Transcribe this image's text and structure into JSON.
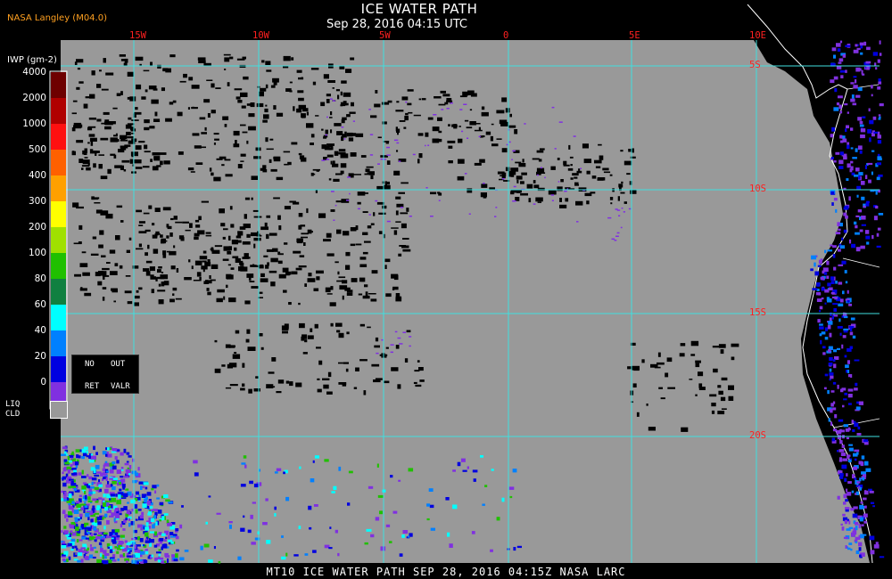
{
  "header": {
    "title": "ICE WATER PATH",
    "subtitle": "Sep 28, 2016 04:15 UTC",
    "producer": "NASA Langley (M04.0)"
  },
  "colorbar": {
    "title": "IWP (gm-2)",
    "labels": [
      "4000",
      "2000",
      "1000",
      "500",
      "400",
      "300",
      "200",
      "100",
      "80",
      "60",
      "40",
      "20",
      "0"
    ],
    "colors": [
      "#6e0000",
      "#b00000",
      "#ff1010",
      "#ff6000",
      "#ffa000",
      "#ffff00",
      "#a0e000",
      "#20c000",
      "#108040",
      "#00ffff",
      "#0080ff",
      "#0000e0",
      "#8030e0"
    ]
  },
  "legend": {
    "no_ret": [
      "NO",
      "RET"
    ],
    "out_valr": [
      "OUT",
      "VALR"
    ],
    "liq_cld": [
      "LIQ",
      "CLD"
    ]
  },
  "map": {
    "lon_labels": [
      "15W",
      "10W",
      "5W",
      "0",
      "5E",
      "10E"
    ],
    "lat_labels": [
      "5S",
      "10S",
      "15S",
      "20S"
    ],
    "grid_color": "#40e0e0",
    "ocean_color": "#999999",
    "clear_color": "#000000",
    "label_color": "#ff2020"
  },
  "footer": {
    "text": "MT10  ICE WATER PATH  SEP 28, 2016 04:15Z  NASA LARC"
  }
}
